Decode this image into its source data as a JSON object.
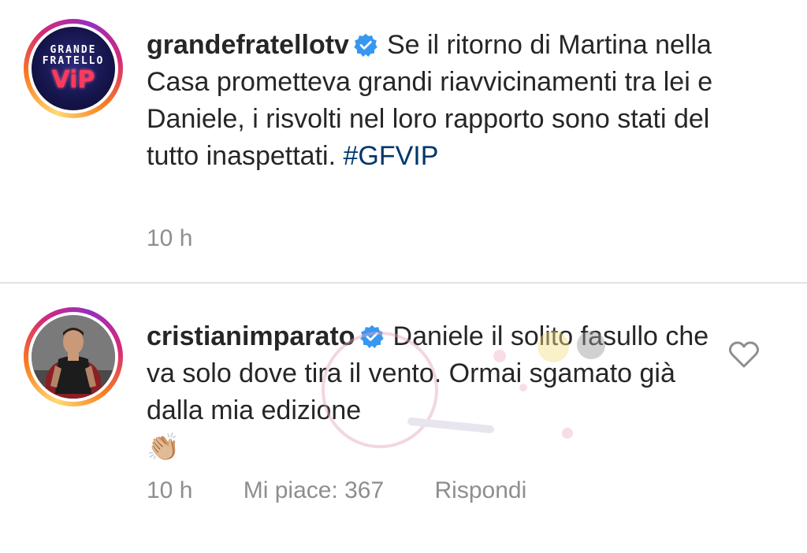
{
  "post": {
    "avatar_logo": {
      "line1": "GRANDE",
      "line2": "FRATELLO",
      "line3": "ViP"
    },
    "username": "grandefratellotv",
    "verified_icon": "verified-badge-icon",
    "text": "Se il ritorno di Martina nella Casa prometteva grandi riavvicinamenti tra lei e Daniele, i risvolti nel loro rapporto sono stati del tutto inaspettati. ",
    "hashtag": "#GFVIP",
    "time": "10 h"
  },
  "comment": {
    "username": "cristianimparato",
    "verified_icon": "verified-badge-icon",
    "text": "Daniele il solito fasullo che va solo dove tira il vento. Ormai sgamato già dalla mia edizione",
    "emoji": "👏🏼",
    "time": "10 h",
    "likes": "Mi piace: 367",
    "reply": "Rispondi",
    "like_icon": "heart-outline-icon"
  },
  "colors": {
    "text": "#262626",
    "secondary": "#8e8e8e",
    "hashtag": "#00376b",
    "verified": "#3897f0",
    "divider": "#e3e3e3"
  }
}
